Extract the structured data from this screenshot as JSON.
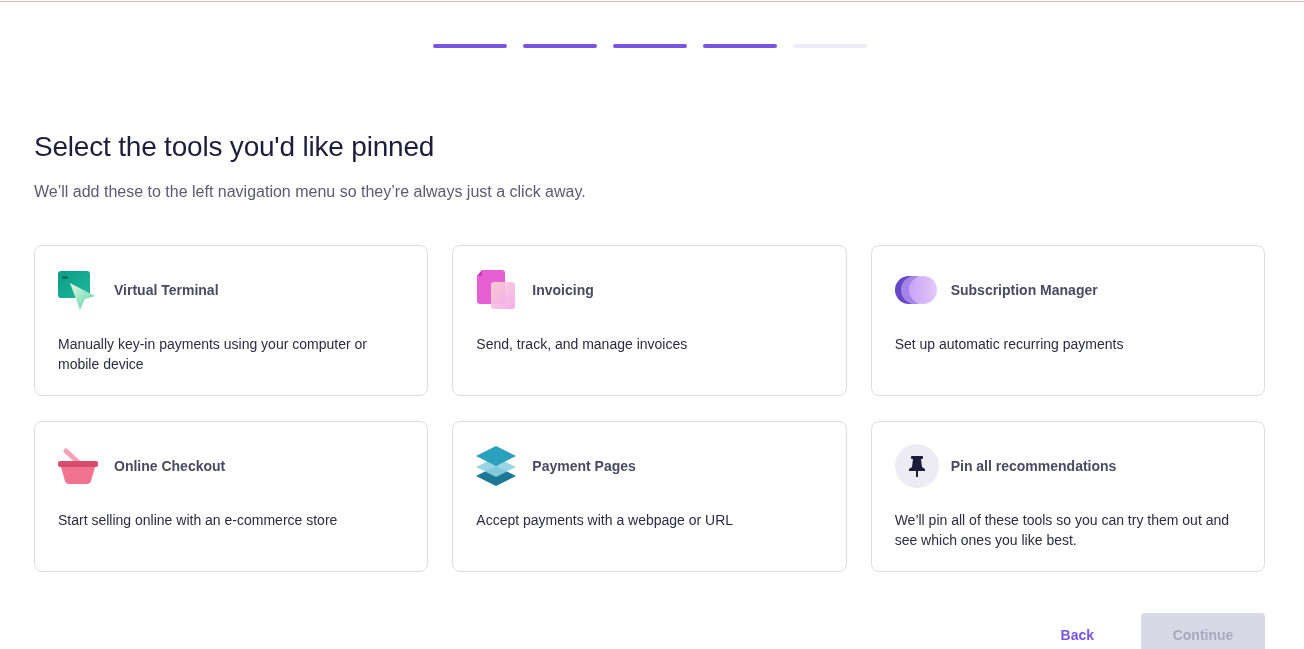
{
  "progress_steps": [
    {
      "completed": true
    },
    {
      "completed": true
    },
    {
      "completed": true
    },
    {
      "completed": true
    },
    {
      "completed": false
    }
  ],
  "title": "Select the tools you'd like pinned",
  "subtitle": "We’ll add these to the left navigation menu so they’re always just a click away.",
  "tools": [
    {
      "name": "Virtual Terminal",
      "description": "Manually key-in payments using your computer or mobile device",
      "selected": false
    },
    {
      "name": "Invoicing",
      "description": "Send, track, and manage invoices",
      "selected": false
    },
    {
      "name": "Subscription Manager",
      "description": "Set up automatic recurring payments",
      "selected": false
    },
    {
      "name": "Online Checkout",
      "description": "Start selling online with an e-commerce store",
      "selected": false
    },
    {
      "name": "Payment Pages",
      "description": "Accept payments with a webpage or URL",
      "selected": false
    },
    {
      "name": "Pin all recommendations",
      "description": "We’ll pin all of these tools so you can try them out and see which ones you like best.",
      "selected": false
    }
  ],
  "actions": {
    "back": "Back",
    "continue": {
      "label": "Continue",
      "disabled": true
    }
  }
}
